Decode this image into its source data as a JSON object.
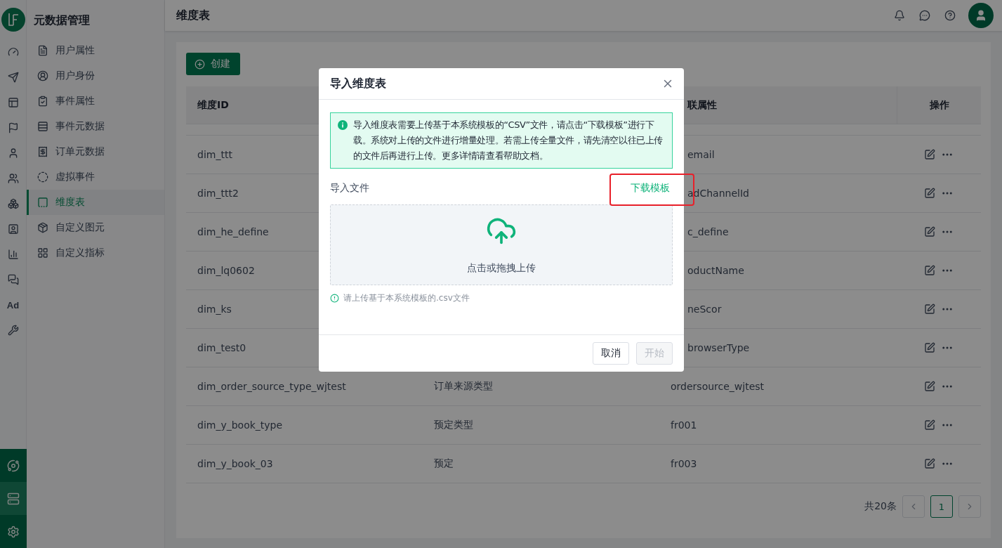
{
  "rail": {
    "ad_label": "Ad",
    "bottom_items": [
      {
        "selected": false
      },
      {
        "selected": true
      },
      {
        "selected": false
      }
    ]
  },
  "menu": {
    "title": "元数据管理",
    "items": [
      {
        "label": "用户属性",
        "selected": false
      },
      {
        "label": "用户身份",
        "selected": false
      },
      {
        "label": "事件属性",
        "selected": false
      },
      {
        "label": "事件元数据",
        "selected": false
      },
      {
        "label": "订单元数据",
        "selected": false
      },
      {
        "label": "虚拟事件",
        "selected": false
      },
      {
        "label": "维度表",
        "selected": true
      },
      {
        "label": "自定义图元",
        "selected": false
      },
      {
        "label": "自定义指标",
        "selected": false
      }
    ]
  },
  "header": {
    "title": "维度表"
  },
  "toolbar": {
    "create_button": "创建"
  },
  "table": {
    "columns": [
      "维度ID",
      "联属性",
      "操作"
    ],
    "rows": [
      {
        "id": "dim_ttt",
        "column_3": "email"
      },
      {
        "id": "dim_ttt2",
        "column_3": "adChannelId"
      },
      {
        "id": "dim_he_define",
        "column_3": "c_define"
      },
      {
        "id": "dim_lq0602",
        "column_3": "oductName"
      },
      {
        "id": "dim_ks",
        "column_3": "neScor"
      },
      {
        "id": "dim_test0",
        "column_3": "browserType"
      },
      {
        "id": "dim_order_source_type_wjtest",
        "column_2": "订单来源类型",
        "column_3": "ordersource_wjtest"
      },
      {
        "id": "dim_y_book_type",
        "column_2": "预定类型",
        "column_3": "fr001"
      },
      {
        "id": "dim_y_book_03",
        "column_2": "预定",
        "column_3": "fr003"
      }
    ]
  },
  "pagination": {
    "total": "共20条",
    "pages": [
      {
        "label": "1",
        "selected": true
      }
    ]
  },
  "modal": {
    "title": "导入维度表",
    "alert": "导入维度表需要上传基于本系统模板的“CSV”文件，请点击“下载模板”进行下载。系统对上传的文件进行增量处理。若需上传全量文件，请先清空以往已上传的文件后再进行上传。更多详情请查看帮助文档。",
    "file_label": "导入文件",
    "download_link": "下载模板",
    "upload_text": "点击或拖拽上传",
    "hint": "请上传基于本系统模板的.csv文件",
    "buttons": [
      {
        "label": "取消",
        "disabled": false
      },
      {
        "label": "开始",
        "disabled": true
      }
    ]
  }
}
